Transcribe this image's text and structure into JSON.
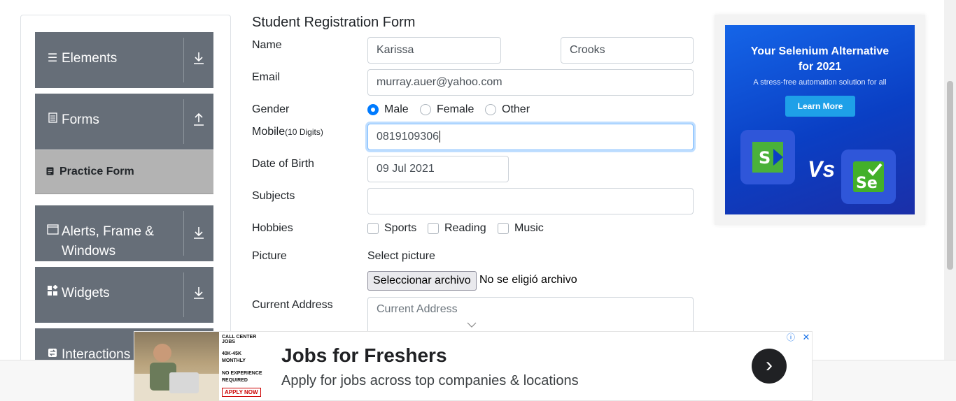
{
  "sidebar": {
    "groups": [
      {
        "label": "Elements",
        "icon": "hamburger-icon",
        "arrow": "download-icon"
      },
      {
        "label": "Forms",
        "icon": "document-icon",
        "arrow": "upload-icon"
      },
      {
        "label": "Alerts, Frame & Windows",
        "label_line1": "Alerts, Frame &",
        "label_line2": "Windows",
        "icon": "window-icon",
        "arrow": "download-icon"
      },
      {
        "label": "Widgets",
        "icon": "widgets-icon",
        "arrow": "download-icon"
      },
      {
        "label": "Interactions",
        "icon": "interactions-icon"
      }
    ],
    "active_item": {
      "label": "Practice Form",
      "icon": "form-icon"
    }
  },
  "form": {
    "title": "Student Registration Form",
    "name_label": "Name",
    "first_name": "Karissa",
    "last_name": "Crooks",
    "email_label": "Email",
    "email": "murray.auer@yahoo.com",
    "gender_label": "Gender",
    "gender_options": [
      "Male",
      "Female",
      "Other"
    ],
    "gender_selected": "Male",
    "mobile_label": "Mobile",
    "mobile_hint": "(10 Digits)",
    "mobile": "0819109306",
    "dob_label": "Date of Birth",
    "dob": "09 Jul 2021",
    "subjects_label": "Subjects",
    "subjects": "",
    "hobbies_label": "Hobbies",
    "hobbies": [
      "Sports",
      "Reading",
      "Music"
    ],
    "picture_label": "Picture",
    "picture_hint": "Select picture",
    "file_button": "Seleccionar archivo",
    "file_status": "No se eligió archivo",
    "address_label": "Current Address",
    "address_placeholder": "Current Address"
  },
  "ad_right": {
    "headline_line1": "Your Selenium Alternative",
    "headline_line2": "for 2021",
    "subtitle": "A stress-free automation solution for all",
    "button": "Learn More",
    "vs": "Vs"
  },
  "ad_bottom": {
    "side_line1": "CALL CENTER JOBS",
    "side_line2": "40K-45K",
    "side_line3": "MONTHLY",
    "side_line4": "NO EXPERIENCE",
    "side_line5": "REQUIRED",
    "side_apply": "APPLY NOW",
    "title": "Jobs for Freshers",
    "subtitle": "Apply for jobs across top companies & locations",
    "info": "ⓘ",
    "close": "✕",
    "go": "›"
  },
  "colors": {
    "sidebar_group": "#666e78",
    "active_item": "#b3b3b3",
    "radio_accent": "#007bff",
    "focus_border": "#80bdff"
  }
}
